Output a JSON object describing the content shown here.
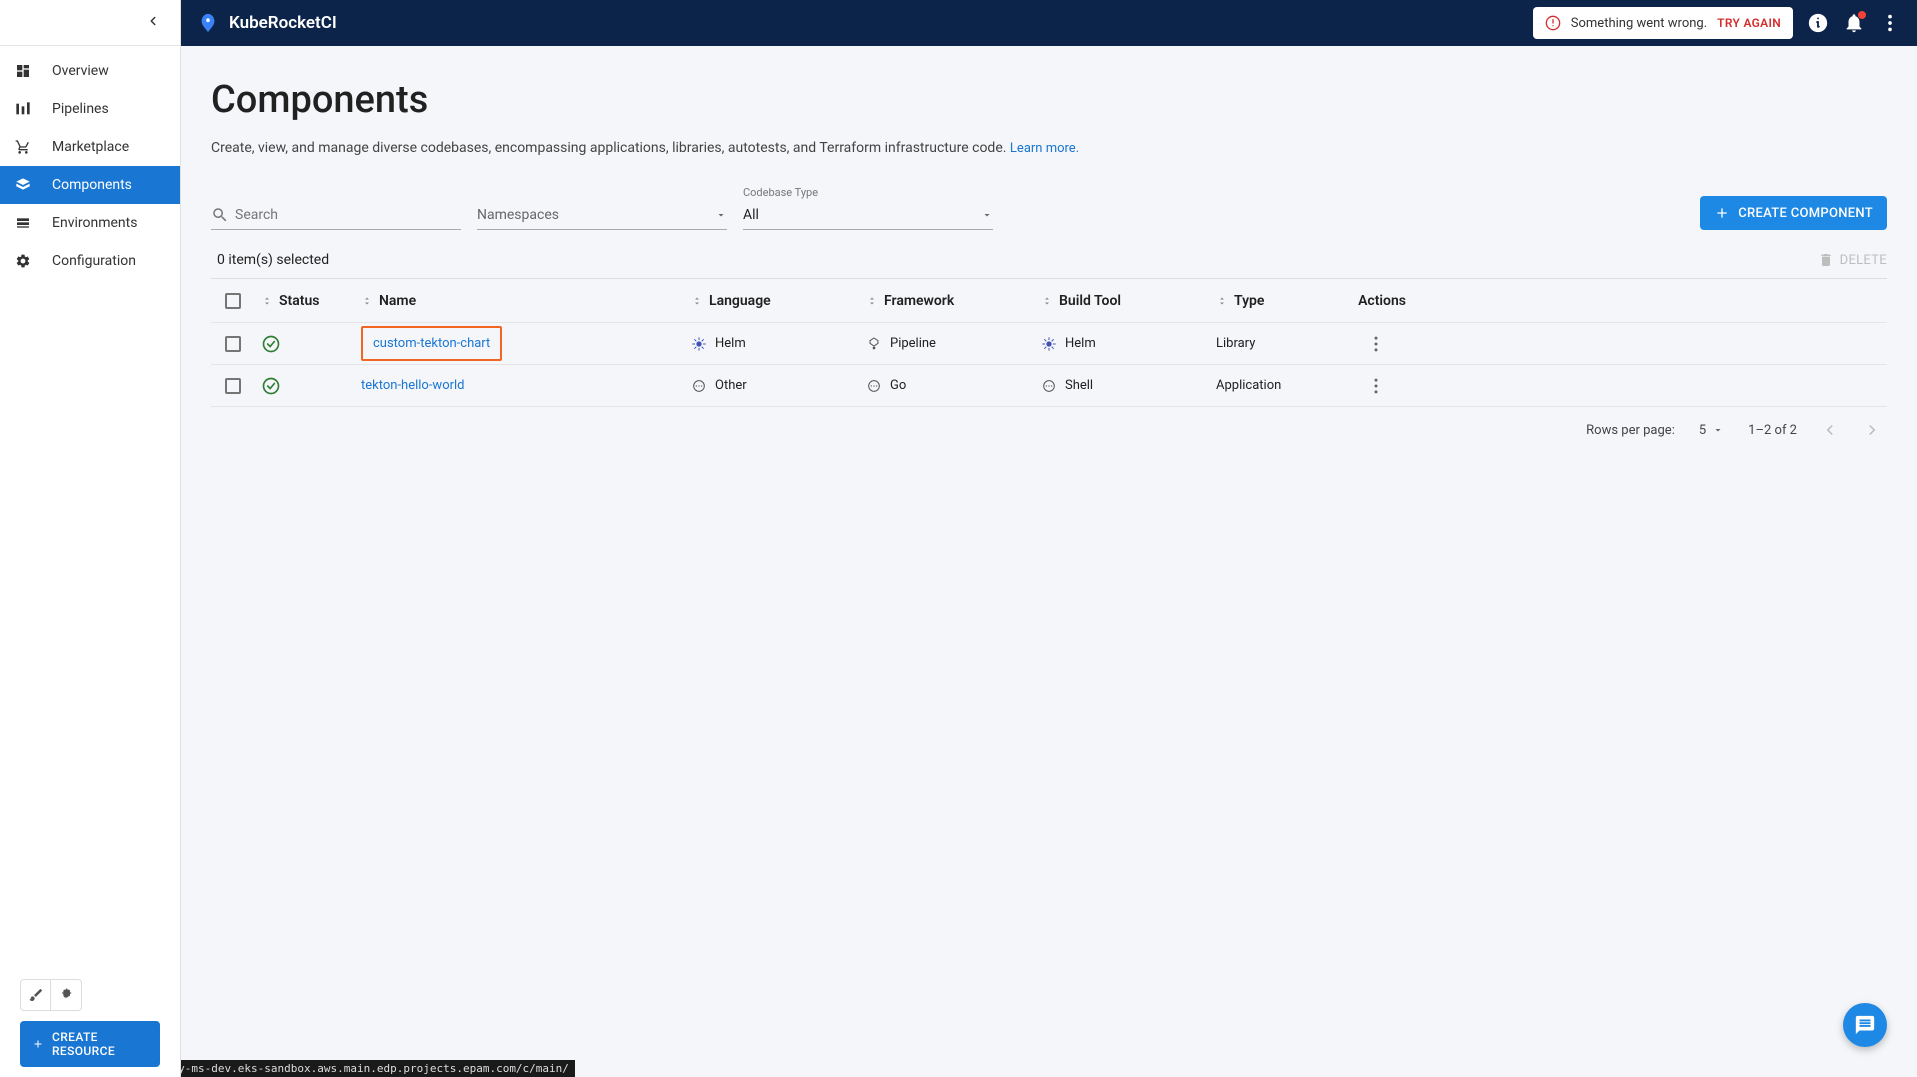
{
  "brand": "KubeRocketCI",
  "alert": {
    "text": "Something went wrong.",
    "action": "TRY AGAIN"
  },
  "sidebar": {
    "items": [
      {
        "label": "Overview"
      },
      {
        "label": "Pipelines"
      },
      {
        "label": "Marketplace"
      },
      {
        "label": "Components"
      },
      {
        "label": "Environments"
      },
      {
        "label": "Configuration"
      }
    ],
    "create_resource": "CREATE RESOURCE"
  },
  "page": {
    "title": "Components",
    "description": "Create, view, and manage diverse codebases, encompassing applications, libraries, autotests, and Terraform infrastructure code.",
    "learn_more": "Learn more."
  },
  "filters": {
    "search_placeholder": "Search",
    "namespaces_label": "Namespaces",
    "codebase_type_label": "Codebase Type",
    "codebase_type_value": "All",
    "create_button": "CREATE COMPONENT"
  },
  "selection": {
    "text": "0 item(s) selected",
    "delete": "DELETE"
  },
  "table": {
    "headers": {
      "status": "Status",
      "name": "Name",
      "language": "Language",
      "framework": "Framework",
      "build_tool": "Build Tool",
      "type": "Type",
      "actions": "Actions"
    },
    "rows": [
      {
        "name": "custom-tekton-chart",
        "language": "Helm",
        "framework": "Pipeline",
        "build_tool": "Helm",
        "type": "Library",
        "highlighted": true
      },
      {
        "name": "tekton-hello-world",
        "language": "Other",
        "framework": "Go",
        "build_tool": "Shell",
        "type": "Application",
        "highlighted": false
      }
    ]
  },
  "pagination": {
    "rows_label": "Rows per page:",
    "per_page": "5",
    "range": "1–2 of 2"
  },
  "statusbar": "https://portal-edp-delivery-ms-dev.eks-sandbox.aws.main.edp.projects.epam.com/c/main/"
}
